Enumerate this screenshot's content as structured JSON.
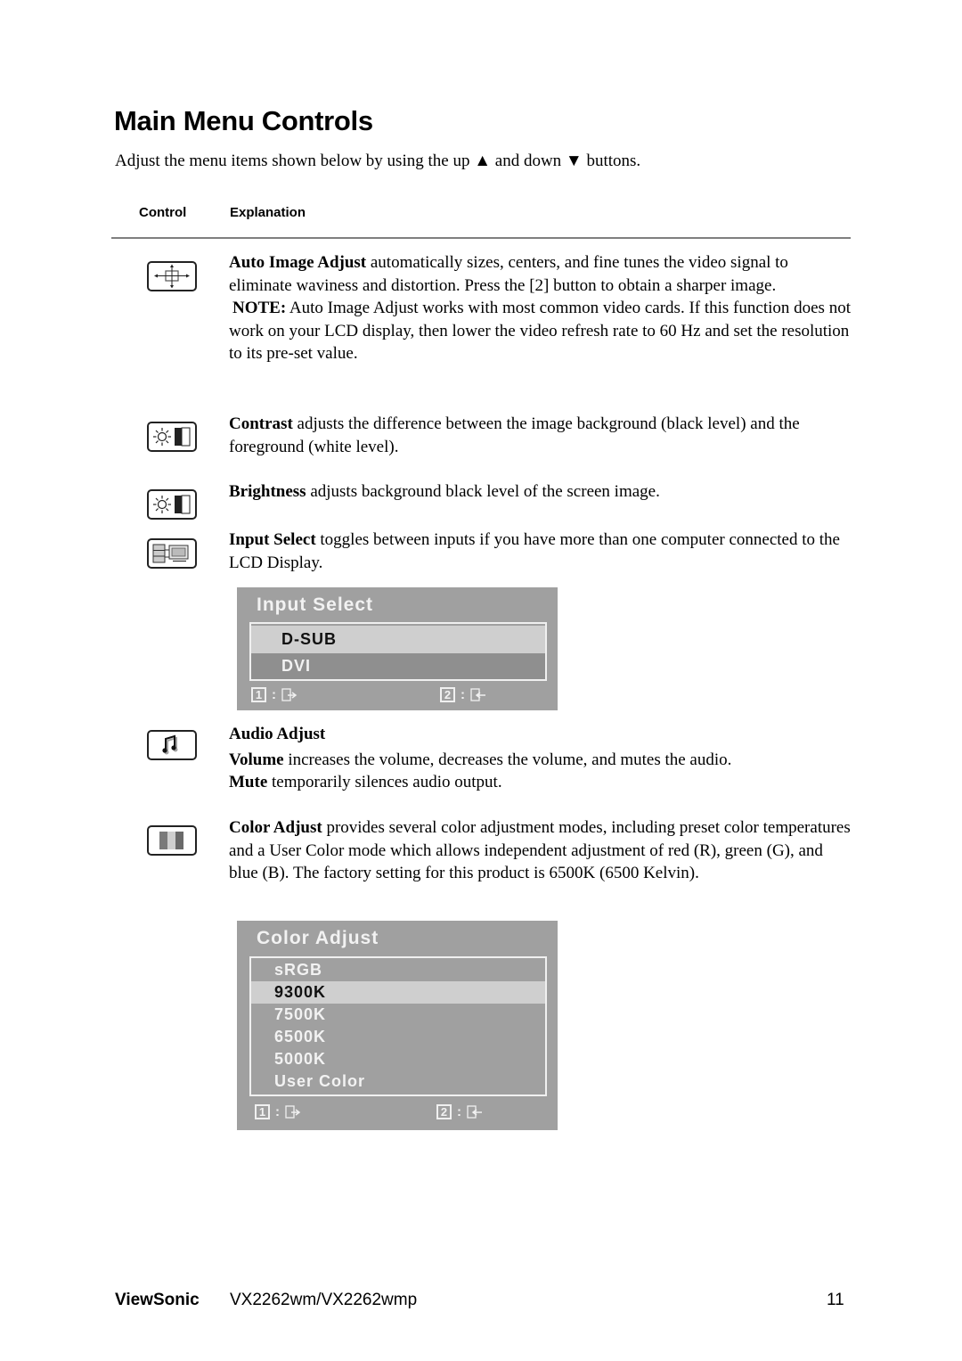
{
  "page": {
    "title": "Main Menu Controls",
    "intro": {
      "before_up": "Adjust the menu items shown below by using the up ",
      "up_symbol": "▲",
      "middle": " and down ",
      "down_symbol": "▼",
      "after_down": " buttons."
    },
    "columns": {
      "control": "Control",
      "explanation": "Explanation"
    }
  },
  "controls": [
    {
      "icon": "auto-image-adjust-icon",
      "name": "Auto Image Adjust",
      "text": " automatically sizes, centers, and fine tunes the video signal to eliminate waviness and distortion. Press the [2] button to obtain a sharper image.",
      "note_label": "NOTE:",
      "note_text": " Auto Image Adjust works with most common video cards. If this function does not work on your LCD display, then lower the video refresh rate to 60 Hz and set the resolution to its pre-set value."
    },
    {
      "icon": "contrast-icon",
      "name": "Contrast",
      "text": " adjusts the difference between the image background  (black level) and the foreground (white level)."
    },
    {
      "icon": "brightness-icon",
      "name": "Brightness",
      "text": " adjusts background black level of the screen image."
    },
    {
      "icon": "input-select-icon",
      "name": "Input Select",
      "text": " toggles between inputs if you have more than one computer connected to the LCD Display."
    },
    {
      "icon": "audio-adjust-icon",
      "name": "Audio Adjust",
      "volume_label": "Volume",
      "volume_text": " increases the volume, decreases the volume, and mutes the audio.",
      "mute_label": "Mute",
      "mute_text": " temporarily silences audio output."
    },
    {
      "icon": "color-adjust-icon",
      "name": "Color Adjust",
      "text": " provides several color adjustment modes, including preset color temperatures and a User Color mode which allows independent adjustment of red (R), green (G), and blue (B). The factory setting for this product is 6500K (6500 Kelvin)."
    }
  ],
  "osd_input_select": {
    "title": "Input Select",
    "options": [
      "D-SUB",
      "DVI"
    ],
    "selected": "D-SUB",
    "footer": [
      {
        "key": "1",
        "sep": ":",
        "icon": "exit-icon"
      },
      {
        "key": "2",
        "sep": ":",
        "icon": "enter-icon"
      }
    ]
  },
  "osd_color_adjust": {
    "title": "Color Adjust",
    "options": [
      "sRGB",
      "9300K",
      "7500K",
      "6500K",
      "5000K",
      "User Color"
    ],
    "selected": "9300K",
    "footer": [
      {
        "key": "1",
        "sep": ":",
        "icon": "exit-icon"
      },
      {
        "key": "2",
        "sep": ":",
        "icon": "enter-icon"
      }
    ]
  },
  "footer": {
    "brand": "ViewSonic",
    "model": "VX2262wm/VX2262wmp",
    "page_number": "11"
  }
}
